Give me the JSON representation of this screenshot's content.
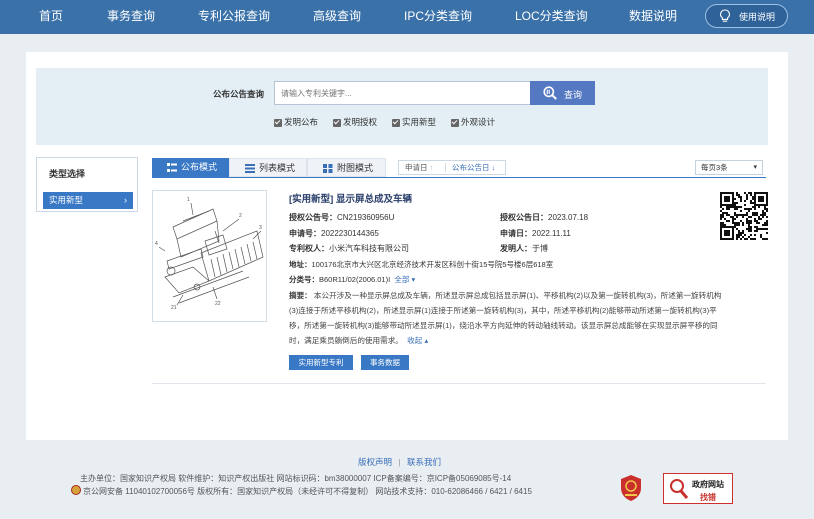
{
  "nav": {
    "items": [
      "首页",
      "事务查询",
      "专利公报查询",
      "高级查询",
      "IPC分类查询",
      "LOC分类查询",
      "数据说明"
    ],
    "help_label": "使用说明"
  },
  "search": {
    "label": "公布公告查询",
    "placeholder": "请输入专利关键字...",
    "button_label": "查询",
    "filters": [
      "发明公布",
      "发明授权",
      "实用新型",
      "外观设计"
    ]
  },
  "sidebar": {
    "title": "类型选择",
    "item": "实用新型",
    "item_chevron": "›"
  },
  "tabs": [
    "公布模式",
    "列表模式",
    "附图模式"
  ],
  "sort": {
    "items": [
      "申请日",
      "公布公告日"
    ],
    "up_arrow": "↑",
    "down_arrow": "↓"
  },
  "per_page": {
    "value": "每页3条",
    "arrow": "▾"
  },
  "result": {
    "title": "[实用新型] 显示屏总成及车辆",
    "grant_no_label": "授权公告号：",
    "grant_no": "CN219360956U",
    "grant_date_label": "授权公告日：",
    "grant_date": "2023.07.18",
    "app_no_label": "申请号：",
    "app_no": "2022230144365",
    "app_date_label": "申请日：",
    "app_date": "2022.11.11",
    "owner_label": "专利权人：",
    "owner": "小米汽车科技有限公司",
    "inventor_label": "发明人：",
    "inventor": "于博",
    "address_label": "地址：",
    "address": "100176北京市大兴区北京经济技术开发区科创十街15号院5号楼6层618室",
    "class_label": "分类号：",
    "class_no": "B60R11/02(2006.01)I",
    "class_all": "全部",
    "class_all_arrow": "▾",
    "abstract_label": "摘要：",
    "abstract_lines": [
      "本公开涉及一种显示屏总成及车辆，所述显示屏总成包括显示屏(1)、平移机构(2)以及第一旋转机构(3)，所述第一旋转机构",
      "(3)连接于所述平移机构(2)，所述显示屏(1)连接于所述第一旋转机构(3)，其中，所述平移机构(2)能够带动所述第一旋转机构(3)平",
      "移，所述第一旋转机构(3)能够带动所述显示屏(1)，绕沿水平方向延伸的转动轴线转动。该显示屏总成能够在实现显示屏平移的同",
      "时，满足乘员躺倒后的使用需求。"
    ],
    "collapse_label": "收起",
    "collapse_arrow": "▴",
    "buttons": [
      "实用新型专利",
      "事务数据"
    ]
  },
  "footer": {
    "links": [
      "版权声明",
      "联系我们"
    ],
    "links_sep": "|",
    "line1": "主办单位：国家知识产权局   软件维护：知识产权出版社   网站标识码：bm38000007   ICP备案编号：京ICP备05069085号-14",
    "line2": "京公网安备 11040102700056号  版权所有：国家知识产权局（未经许可不得复制）   网站技术支持：010-62086466 / 6421 / 6415",
    "gov_title": "政府网站",
    "gov_sub": "找错"
  }
}
